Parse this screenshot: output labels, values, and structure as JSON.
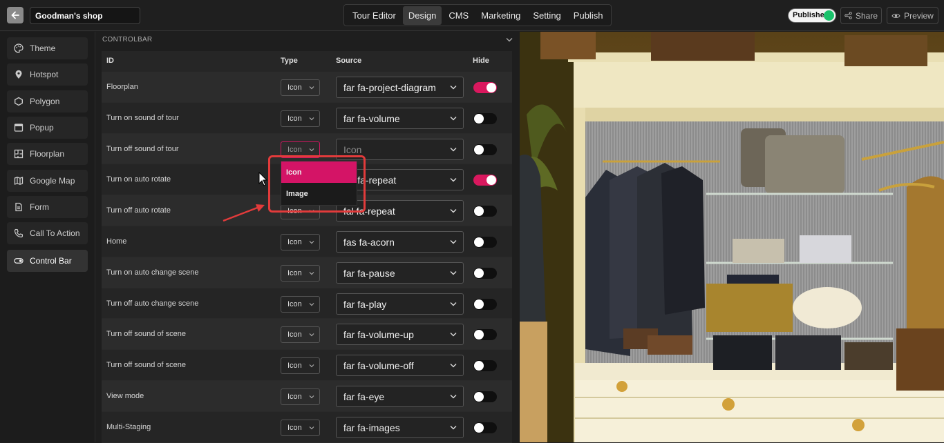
{
  "topbar": {
    "shop_name": "Goodman's shop",
    "nav_tabs": [
      "Tour Editor",
      "Design",
      "CMS",
      "Marketing",
      "Setting",
      "Publish"
    ],
    "active_tab": "Design",
    "published_label": "Published",
    "share_label": "Share",
    "preview_label": "Preview"
  },
  "sidebar": {
    "items": [
      {
        "label": "Theme",
        "icon": "palette-icon"
      },
      {
        "label": "Hotspot",
        "icon": "map-pin-icon"
      },
      {
        "label": "Polygon",
        "icon": "polygon-icon"
      },
      {
        "label": "Popup",
        "icon": "window-icon"
      },
      {
        "label": "Floorplan",
        "icon": "floorplan-icon"
      },
      {
        "label": "Google Map",
        "icon": "map-icon"
      },
      {
        "label": "Form",
        "icon": "document-icon"
      },
      {
        "label": "Call To Action",
        "icon": "phone-icon"
      },
      {
        "label": "Control Bar",
        "icon": "toggle-icon"
      }
    ],
    "active": "Control Bar"
  },
  "panel": {
    "section_title": "CONTROLBAR",
    "columns": {
      "id": "ID",
      "type": "Type",
      "source": "Source",
      "hide": "Hide"
    },
    "rows": [
      {
        "id": "Floorplan",
        "type": "Icon",
        "source": "far fa-project-diagram",
        "hide": true
      },
      {
        "id": "Turn on sound of tour",
        "type": "Icon",
        "source": "far fa-volume",
        "hide": false
      },
      {
        "id": "Turn off sound of tour",
        "type": "Icon",
        "source": "Icon",
        "hide": false
      },
      {
        "id": "Turn on auto rotate",
        "type": "Icon",
        "source": "far fa-repeat",
        "hide": true
      },
      {
        "id": "Turn off auto rotate",
        "type": "Icon",
        "source": "fal fa-repeat",
        "hide": false
      },
      {
        "id": "Home",
        "type": "Icon",
        "source": "fas fa-acorn",
        "hide": false
      },
      {
        "id": "Turn on auto change scene",
        "type": "Icon",
        "source": "far fa-pause",
        "hide": false
      },
      {
        "id": "Turn off auto change scene",
        "type": "Icon",
        "source": "far fa-play",
        "hide": false
      },
      {
        "id": "Turn off sound of scene",
        "type": "Icon",
        "source": "far fa-volume-up",
        "hide": false
      },
      {
        "id": "Turn off sound of scene",
        "type": "Icon",
        "source": "far fa-volume-off",
        "hide": false
      },
      {
        "id": "View mode",
        "type": "Icon",
        "source": "far fa-eye",
        "hide": false
      },
      {
        "id": "Multi-Staging",
        "type": "Icon",
        "source": "far fa-images",
        "hide": false
      }
    ],
    "dropdown_options": [
      "Icon",
      "Image"
    ],
    "dropdown_selected": "Icon"
  },
  "colors": {
    "accent": "#d9185e",
    "annotation": "#e23b3b",
    "published_dot": "#19c26b"
  }
}
